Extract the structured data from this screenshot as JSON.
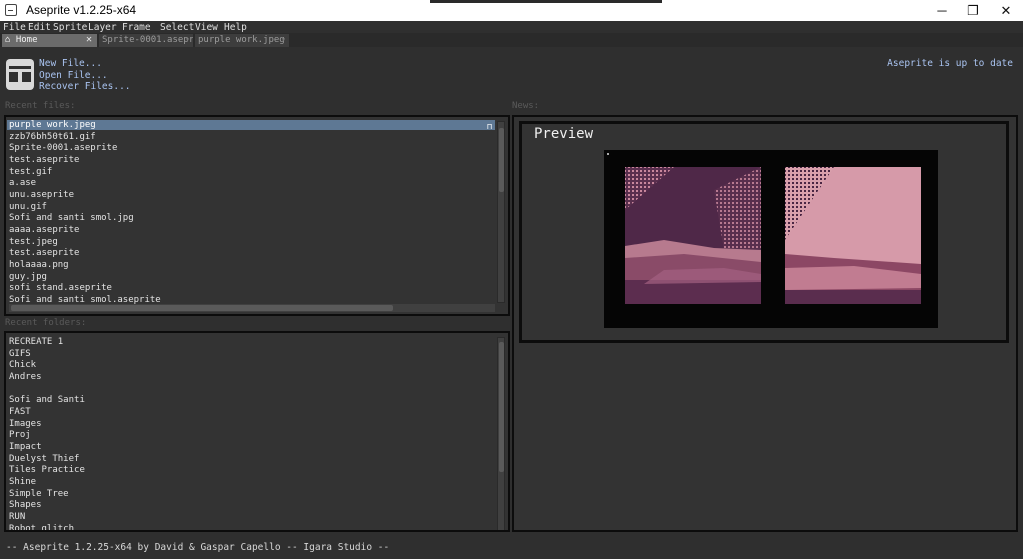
{
  "window": {
    "title": "Aseprite v1.2.25-x64",
    "minimize_glyph": "─",
    "maximize_glyph": "❐",
    "close_glyph": "✕"
  },
  "menu": [
    "File",
    "Edit",
    "Sprite",
    "Layer",
    "Frame",
    "Select",
    "View",
    "Help"
  ],
  "tabs": [
    {
      "label": "Home",
      "icon": "home-icon",
      "active": true,
      "close_glyph": "✕"
    },
    {
      "label": "Sprite-0001.asepri",
      "active": false
    },
    {
      "label": "purple work.jpeg",
      "active": false
    }
  ],
  "home": {
    "links": [
      "New File...",
      "Open File...",
      "Recover Files..."
    ],
    "update_status": "Aseprite is up to date"
  },
  "recent_files": {
    "label": "Recent files:",
    "items": [
      "purple work.jpeg",
      "zzb76bh50t61.gif",
      "Sprite-0001.aseprite",
      "test.aseprite",
      "test.gif",
      "a.ase",
      "unu.aseprite",
      "unu.gif",
      "Sofi and santi smol.jpg",
      "aaaa.aseprite",
      "test.jpeg",
      "test.aseprite",
      "holaaaa.png",
      "guy.jpg",
      "sofi stand.aseprite",
      "Sofi and santi smol.aseprite"
    ],
    "selected_index": 0,
    "pin_icon": "pin-icon"
  },
  "recent_folders": {
    "label": "Recent folders:",
    "items": [
      "RECREATE 1",
      "GIFS",
      "Chick",
      "Andres",
      "",
      "Sofi and Santi",
      "FAST",
      "Images",
      "Proj",
      "Impact",
      "Duelyst Thief",
      "Tiles Practice",
      "Shine",
      "Simple Tree",
      "Shapes",
      "RUN",
      "Robot glitch"
    ]
  },
  "news": {
    "label": "News:",
    "preview_title": "Preview"
  },
  "status_bar": {
    "text": "-- Aseprite 1.2.25-x64 by David & Gaspar Capello -- Igara Studio --"
  },
  "colors": {
    "background": "#2f2f2f",
    "panel": "#333333",
    "selection": "#5e7894",
    "link": "#a9c3f0"
  }
}
